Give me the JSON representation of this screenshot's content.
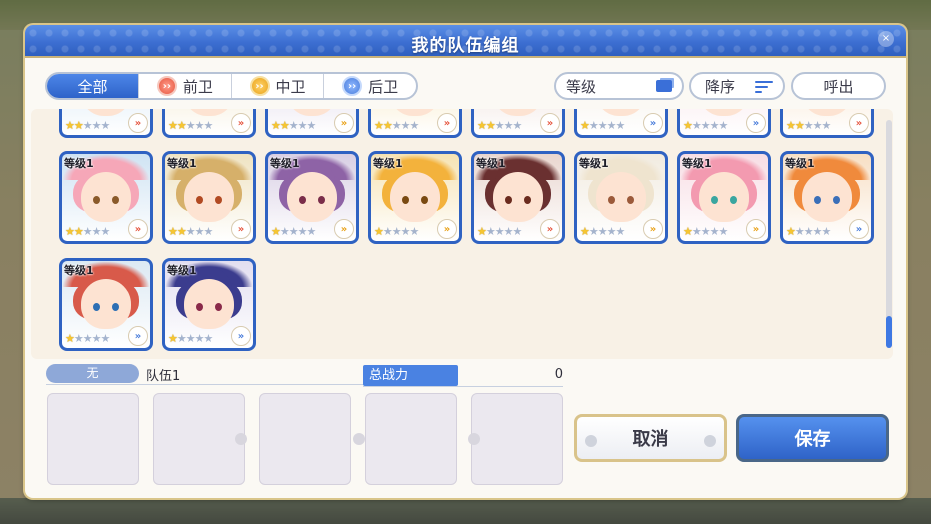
{
  "dialog": {
    "title": "我的队伍编组"
  },
  "filters": {
    "tabs": [
      {
        "label": "全部",
        "active": true
      },
      {
        "label": "前卫",
        "icon": "front-position-icon"
      },
      {
        "label": "中卫",
        "icon": "middle-position-icon"
      },
      {
        "label": "后卫",
        "icon": "back-position-icon"
      }
    ]
  },
  "sort": {
    "level_label": "等级",
    "order_label": "降序",
    "call_label": "呼出"
  },
  "characters": [
    {
      "level": "等级1",
      "stars": 2,
      "hair": "#f6a7b8",
      "eye": "#8a5a2a",
      "rank_color": "#e6553f"
    },
    {
      "level": "等级1",
      "stars": 2,
      "hair": "#d6b06a",
      "eye": "#b24a22",
      "rank_color": "#e6553f"
    },
    {
      "level": "等级1",
      "stars": 1,
      "hair": "#8e63a6",
      "eye": "#7a2d4a",
      "rank_color": "#e9a219"
    },
    {
      "level": "等级1",
      "stars": 1,
      "hair": "#f3b23c",
      "eye": "#7a4a12",
      "rank_color": "#e9a219"
    },
    {
      "level": "等级1",
      "stars": 1,
      "hair": "#6a3030",
      "eye": "#6b2b1e",
      "rank_color": "#e6553f"
    },
    {
      "level": "等级1",
      "stars": 1,
      "hair": "#efe4cf",
      "eye": "#9b5a3a",
      "rank_color": "#e9a219"
    },
    {
      "level": "等级1",
      "stars": 1,
      "hair": "#f39ab0",
      "eye": "#3aa6a0",
      "rank_color": "#e9a219"
    },
    {
      "level": "等级1",
      "stars": 1,
      "hair": "#f08a3c",
      "eye": "#3b6fb8",
      "rank_color": "#4a7ddb"
    },
    {
      "level": "等级1",
      "stars": 1,
      "hair": "#d85a4a",
      "eye": "#2d6fb4",
      "rank_color": "#4a7ddb"
    },
    {
      "level": "等级1",
      "stars": 1,
      "hair": "#3b3c8e",
      "eye": "#8a2a4a",
      "rank_color": "#4a7ddb"
    }
  ],
  "party": {
    "tag": "无",
    "name": "队伍1",
    "power_label": "总战力",
    "power_value": "0"
  },
  "buttons": {
    "cancel": "取消",
    "save": "保存"
  },
  "colors": {
    "title_bar": "#3d6fd2",
    "accent_blue": "#2f62c2",
    "gold_border": "#d9c38a"
  },
  "scrollbar": {
    "position_fraction": 0.86
  }
}
